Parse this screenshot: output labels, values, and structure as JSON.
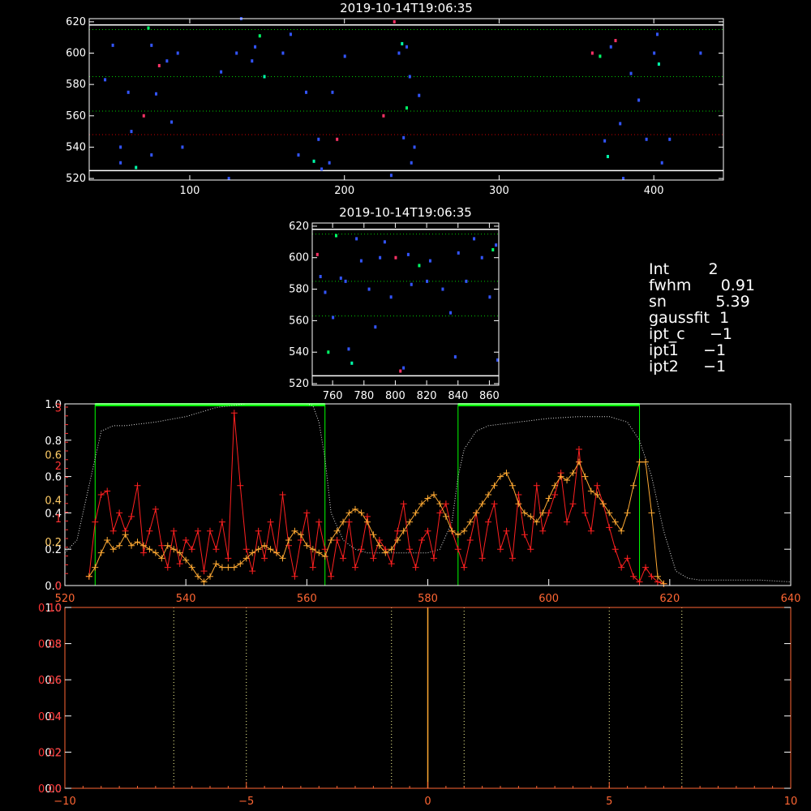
{
  "chart_data": [
    {
      "type": "scatter",
      "title": "2019-10-14T19:06:35",
      "xlim": [
        35,
        445
      ],
      "ylim": [
        519,
        622
      ],
      "x_ticks": [
        "100",
        "200",
        "300",
        "400"
      ],
      "y_ticks": [
        "520",
        "540",
        "560",
        "580",
        "600",
        "620"
      ],
      "hlines": [
        {
          "y": 618,
          "style": "solid",
          "color": "#ffffff"
        },
        {
          "y": 615,
          "style": "dotted",
          "color": "#00cc00"
        },
        {
          "y": 585,
          "style": "dotted",
          "color": "#00cc00"
        },
        {
          "y": 563,
          "style": "dotted",
          "color": "#00cc00"
        },
        {
          "y": 548,
          "style": "dotted",
          "color": "#cc0000"
        },
        {
          "y": 525,
          "style": "solid",
          "color": "#ffffff"
        }
      ],
      "points": [
        [
          45,
          583,
          "#3355ff"
        ],
        [
          50,
          605,
          "#3355ff"
        ],
        [
          55,
          540,
          "#3355ff"
        ],
        [
          55,
          530,
          "#3355ff"
        ],
        [
          60,
          575,
          "#3355ff"
        ],
        [
          62,
          550,
          "#3355ff"
        ],
        [
          65,
          527,
          "#00ffaa"
        ],
        [
          70,
          560,
          "#ff3366"
        ],
        [
          73,
          616,
          "#00ff66"
        ],
        [
          75,
          605,
          "#3355ff"
        ],
        [
          75,
          535,
          "#3355ff"
        ],
        [
          78,
          574,
          "#3355ff"
        ],
        [
          80,
          592,
          "#ff3366"
        ],
        [
          85,
          595,
          "#3355ff"
        ],
        [
          88,
          556,
          "#3355ff"
        ],
        [
          92,
          600,
          "#3355ff"
        ],
        [
          95,
          540,
          "#3355ff"
        ],
        [
          120,
          588,
          "#3355ff"
        ],
        [
          125,
          520,
          "#3355ff"
        ],
        [
          130,
          600,
          "#3355ff"
        ],
        [
          133,
          622,
          "#3355ff"
        ],
        [
          140,
          595,
          "#3355ff"
        ],
        [
          142,
          604,
          "#3355ff"
        ],
        [
          145,
          611,
          "#00ff66"
        ],
        [
          148,
          585,
          "#00ffaa"
        ],
        [
          160,
          600,
          "#3355ff"
        ],
        [
          165,
          612,
          "#3355ff"
        ],
        [
          170,
          535,
          "#3355ff"
        ],
        [
          175,
          575,
          "#3355ff"
        ],
        [
          180,
          531,
          "#00ffaa"
        ],
        [
          183,
          545,
          "#3355ff"
        ],
        [
          185,
          526,
          "#3355ff"
        ],
        [
          190,
          530,
          "#3355ff"
        ],
        [
          192,
          575,
          "#3355ff"
        ],
        [
          195,
          545,
          "#ff3366"
        ],
        [
          200,
          598,
          "#3355ff"
        ],
        [
          225,
          560,
          "#ff3366"
        ],
        [
          230,
          522,
          "#3355ff"
        ],
        [
          232,
          620,
          "#ff3366"
        ],
        [
          235,
          600,
          "#3355ff"
        ],
        [
          237,
          606,
          "#00ffaa"
        ],
        [
          240,
          604,
          "#3355ff"
        ],
        [
          242,
          585,
          "#3355ff"
        ],
        [
          238,
          546,
          "#3355ff"
        ],
        [
          240,
          565,
          "#00ff66"
        ],
        [
          243,
          530,
          "#3355ff"
        ],
        [
          245,
          540,
          "#3355ff"
        ],
        [
          248,
          573,
          "#3355ff"
        ],
        [
          360,
          600,
          "#ff3366"
        ],
        [
          365,
          598,
          "#00ff66"
        ],
        [
          368,
          544,
          "#3355ff"
        ],
        [
          370,
          534,
          "#00ffaa"
        ],
        [
          372,
          604,
          "#3355ff"
        ],
        [
          375,
          608,
          "#ff3366"
        ],
        [
          378,
          555,
          "#3355ff"
        ],
        [
          380,
          520,
          "#3355ff"
        ],
        [
          385,
          587,
          "#3355ff"
        ],
        [
          390,
          570,
          "#3355ff"
        ],
        [
          395,
          545,
          "#3355ff"
        ],
        [
          400,
          600,
          "#3355ff"
        ],
        [
          402,
          612,
          "#3355ff"
        ],
        [
          403,
          593,
          "#00ffaa"
        ],
        [
          405,
          530,
          "#3355ff"
        ],
        [
          410,
          545,
          "#3355ff"
        ],
        [
          430,
          600,
          "#3355ff"
        ]
      ]
    },
    {
      "type": "scatter",
      "title": "2019-10-14T19:06:35",
      "xlim": [
        747,
        866
      ],
      "ylim": [
        519,
        622
      ],
      "x_ticks": [
        "760",
        "780",
        "800",
        "820",
        "840",
        "860"
      ],
      "y_ticks": [
        "520",
        "540",
        "560",
        "580",
        "600",
        "620"
      ],
      "hlines": [
        {
          "y": 618,
          "style": "solid",
          "color": "#ffffff"
        },
        {
          "y": 615,
          "style": "dotted",
          "color": "#00cc00"
        },
        {
          "y": 585,
          "style": "dotted",
          "color": "#00cc00"
        },
        {
          "y": 563,
          "style": "dotted",
          "color": "#00cc00"
        },
        {
          "y": 525,
          "style": "solid",
          "color": "#ffffff"
        }
      ],
      "points": [
        [
          750,
          602,
          "#ff3366"
        ],
        [
          752,
          588,
          "#3355ff"
        ],
        [
          755,
          578,
          "#3355ff"
        ],
        [
          757,
          540,
          "#00ff66"
        ],
        [
          760,
          562,
          "#3355ff"
        ],
        [
          762,
          614,
          "#00ff66"
        ],
        [
          765,
          587,
          "#3355ff"
        ],
        [
          768,
          585,
          "#3355ff"
        ],
        [
          770,
          542,
          "#3355ff"
        ],
        [
          772,
          533,
          "#00ffaa"
        ],
        [
          775,
          612,
          "#3355ff"
        ],
        [
          778,
          598,
          "#3355ff"
        ],
        [
          783,
          580,
          "#3355ff"
        ],
        [
          787,
          556,
          "#3355ff"
        ],
        [
          790,
          600,
          "#3355ff"
        ],
        [
          793,
          610,
          "#3355ff"
        ],
        [
          797,
          575,
          "#3355ff"
        ],
        [
          800,
          600,
          "#ff3366"
        ],
        [
          803,
          528,
          "#ff3366"
        ],
        [
          805,
          530,
          "#3355ff"
        ],
        [
          808,
          602,
          "#3355ff"
        ],
        [
          810,
          583,
          "#3355ff"
        ],
        [
          815,
          595,
          "#00ff66"
        ],
        [
          820,
          585,
          "#3355ff"
        ],
        [
          822,
          598,
          "#3355ff"
        ],
        [
          830,
          580,
          "#3355ff"
        ],
        [
          835,
          565,
          "#3355ff"
        ],
        [
          838,
          537,
          "#3355ff"
        ],
        [
          840,
          603,
          "#3355ff"
        ],
        [
          845,
          585,
          "#3355ff"
        ],
        [
          850,
          612,
          "#3355ff"
        ],
        [
          855,
          600,
          "#3355ff"
        ],
        [
          860,
          575,
          "#3355ff"
        ],
        [
          862,
          605,
          "#00ff66"
        ],
        [
          864,
          608,
          "#3355ff"
        ],
        [
          865,
          535,
          "#3355ff"
        ]
      ]
    },
    {
      "type": "line",
      "xlim": [
        520,
        640
      ],
      "ylim": [
        0,
        1.0
      ],
      "x_ticks": [
        "520",
        "540",
        "560",
        "580",
        "600",
        "620",
        "640"
      ],
      "y_ticks_left_white": [
        "0.0",
        "0.2",
        "0.4",
        "0.6",
        "0.8",
        "1.0"
      ],
      "y_ticks_left_red": [
        "0",
        "1",
        "2",
        "3"
      ],
      "y_ticks_left_orange": [
        "0.2",
        "0.4",
        "0.6"
      ],
      "green_box_1": [
        525,
        563
      ],
      "green_box_2": [
        585,
        615
      ],
      "series": [
        {
          "color": "#dddddd",
          "style": "dotted",
          "x": [
            520,
            522,
            524,
            526,
            528,
            530,
            535,
            540,
            545,
            550,
            555,
            560,
            561,
            562,
            563,
            564,
            566,
            568,
            570,
            575,
            580,
            582,
            584,
            585,
            586,
            588,
            590,
            595,
            600,
            605,
            610,
            613,
            615,
            617,
            619,
            621,
            623,
            625,
            630,
            635,
            640
          ],
          "values": [
            0.18,
            0.25,
            0.55,
            0.85,
            0.88,
            0.88,
            0.9,
            0.93,
            0.98,
            1.0,
            1.0,
            1.0,
            0.99,
            0.9,
            0.7,
            0.4,
            0.25,
            0.2,
            0.18,
            0.18,
            0.18,
            0.2,
            0.35,
            0.6,
            0.75,
            0.85,
            0.88,
            0.9,
            0.92,
            0.93,
            0.93,
            0.9,
            0.8,
            0.6,
            0.3,
            0.08,
            0.04,
            0.03,
            0.03,
            0.03,
            0.02
          ]
        },
        {
          "color": "#ff2020",
          "style": "solid",
          "x": [
            524,
            525,
            526,
            527,
            528,
            529,
            530,
            531,
            532,
            533,
            534,
            535,
            536,
            537,
            538,
            539,
            540,
            541,
            542,
            543,
            544,
            545,
            546,
            547,
            548,
            549,
            550,
            551,
            552,
            553,
            554,
            555,
            556,
            557,
            558,
            559,
            560,
            561,
            562,
            563,
            564,
            565,
            566,
            567,
            568,
            569,
            570,
            571,
            572,
            573,
            574,
            575,
            576,
            577,
            578,
            579,
            580,
            581,
            582,
            583,
            584,
            585,
            586,
            587,
            588,
            589,
            590,
            591,
            592,
            593,
            594,
            595,
            596,
            597,
            598,
            599,
            600,
            601,
            602,
            603,
            604,
            605,
            606,
            607,
            608,
            609,
            610,
            611,
            612,
            613,
            614,
            615,
            616,
            617,
            618,
            619
          ],
          "values": [
            0.05,
            0.35,
            0.5,
            0.52,
            0.3,
            0.4,
            0.3,
            0.38,
            0.55,
            0.18,
            0.3,
            0.42,
            0.22,
            0.1,
            0.3,
            0.12,
            0.25,
            0.2,
            0.3,
            0.08,
            0.3,
            0.2,
            0.35,
            0.15,
            0.95,
            0.55,
            0.2,
            0.08,
            0.3,
            0.15,
            0.35,
            0.18,
            0.5,
            0.22,
            0.05,
            0.25,
            0.4,
            0.1,
            0.35,
            0.2,
            0.05,
            0.25,
            0.15,
            0.35,
            0.1,
            0.2,
            0.38,
            0.15,
            0.25,
            0.2,
            0.12,
            0.3,
            0.45,
            0.2,
            0.1,
            0.25,
            0.3,
            0.15,
            0.4,
            0.45,
            0.3,
            0.2,
            0.1,
            0.25,
            0.4,
            0.15,
            0.35,
            0.45,
            0.2,
            0.3,
            0.15,
            0.5,
            0.28,
            0.2,
            0.55,
            0.3,
            0.4,
            0.5,
            0.62,
            0.35,
            0.45,
            0.75,
            0.4,
            0.3,
            0.55,
            0.45,
            0.32,
            0.2,
            0.1,
            0.15,
            0.05,
            0.02,
            0.1,
            0.05,
            0.02,
            0.01
          ]
        },
        {
          "color": "#ffaa33",
          "style": "solid",
          "x": [
            524,
            525,
            526,
            527,
            528,
            529,
            530,
            531,
            532,
            533,
            534,
            535,
            536,
            537,
            538,
            539,
            540,
            541,
            542,
            543,
            544,
            545,
            546,
            547,
            548,
            549,
            550,
            551,
            552,
            553,
            554,
            555,
            556,
            557,
            558,
            559,
            560,
            561,
            562,
            563,
            564,
            565,
            566,
            567,
            568,
            569,
            570,
            571,
            572,
            573,
            574,
            575,
            576,
            577,
            578,
            579,
            580,
            581,
            582,
            583,
            584,
            585,
            586,
            587,
            588,
            589,
            590,
            591,
            592,
            593,
            594,
            595,
            596,
            597,
            598,
            599,
            600,
            601,
            602,
            603,
            604,
            605,
            606,
            607,
            608,
            609,
            610,
            611,
            612,
            613,
            614,
            615,
            616,
            617,
            618,
            619
          ],
          "values": [
            0.05,
            0.1,
            0.18,
            0.25,
            0.2,
            0.22,
            0.28,
            0.22,
            0.24,
            0.22,
            0.2,
            0.18,
            0.15,
            0.22,
            0.2,
            0.18,
            0.14,
            0.1,
            0.05,
            0.02,
            0.05,
            0.12,
            0.1,
            0.1,
            0.1,
            0.12,
            0.15,
            0.18,
            0.2,
            0.22,
            0.2,
            0.18,
            0.15,
            0.25,
            0.3,
            0.28,
            0.22,
            0.2,
            0.18,
            0.16,
            0.25,
            0.3,
            0.35,
            0.4,
            0.42,
            0.4,
            0.35,
            0.28,
            0.22,
            0.18,
            0.2,
            0.25,
            0.3,
            0.35,
            0.4,
            0.45,
            0.48,
            0.5,
            0.45,
            0.38,
            0.3,
            0.28,
            0.3,
            0.35,
            0.4,
            0.45,
            0.5,
            0.55,
            0.6,
            0.62,
            0.55,
            0.45,
            0.4,
            0.38,
            0.35,
            0.4,
            0.48,
            0.55,
            0.6,
            0.58,
            0.62,
            0.68,
            0.6,
            0.52,
            0.5,
            0.45,
            0.4,
            0.35,
            0.3,
            0.4,
            0.55,
            0.68,
            0.68,
            0.4,
            0.05,
            0.01
          ]
        }
      ]
    },
    {
      "type": "line",
      "xlim": [
        -10,
        10
      ],
      "ylim": [
        0,
        1.0
      ],
      "x_ticks": [
        "−10",
        "−5",
        "0",
        "5",
        "10"
      ],
      "y_ticks_left_white": [
        "0.0",
        "0.2",
        "0.4",
        "0.6",
        "0.8",
        "1.0"
      ],
      "y_ticks_left_red": [
        "0.00",
        "0.02",
        "0.04",
        "0.06",
        "0.08",
        "0.10"
      ],
      "vlines_dotted": [
        -7,
        -5,
        -1,
        1,
        5,
        7
      ],
      "vline_solid": 0
    }
  ],
  "info_panel": [
    {
      "key": "Int",
      "value": "2"
    },
    {
      "key": "fwhm",
      "value": "0.91"
    },
    {
      "key": "sn",
      "value": "5.39"
    },
    {
      "key": "gaussfit",
      "value": "1"
    },
    {
      "key": "ipt_c",
      "value": "−1"
    },
    {
      "key": "ipt1",
      "value": "−1"
    },
    {
      "key": "ipt2",
      "value": "−1"
    }
  ]
}
